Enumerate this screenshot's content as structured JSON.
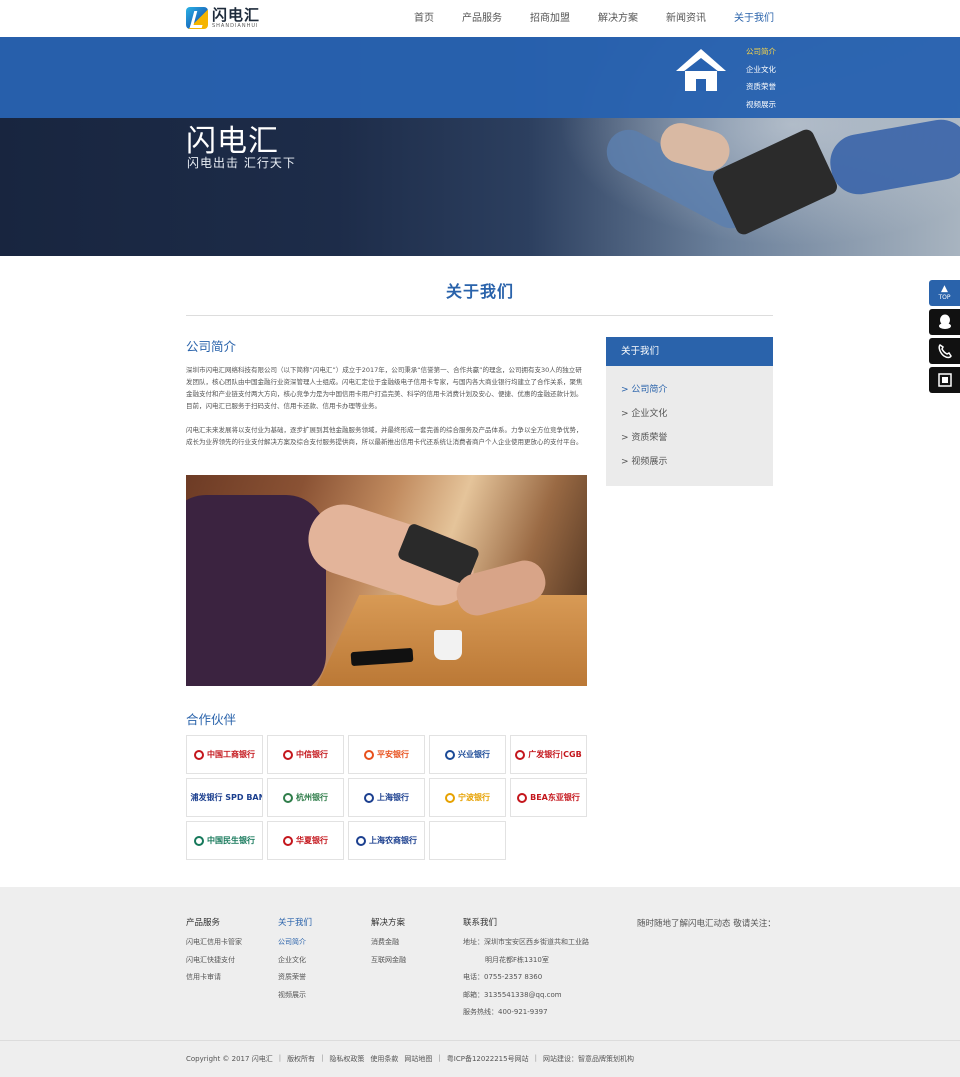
{
  "logo": {
    "name": "闪电汇",
    "sub": "SHANDIANHUI"
  },
  "nav": [
    {
      "label": "首页",
      "active": false
    },
    {
      "label": "产品服务",
      "active": false
    },
    {
      "label": "招商加盟",
      "active": false
    },
    {
      "label": "解决方案",
      "active": false
    },
    {
      "label": "新闻资讯",
      "active": false
    },
    {
      "label": "关于我们",
      "active": true
    }
  ],
  "dropdown": {
    "icon": "home-icon",
    "items": [
      "公司简介",
      "企业文化",
      "资质荣誉",
      "视频展示"
    ],
    "active_index": 0
  },
  "banner": {
    "title": "闪电汇",
    "subtitle": "闪电出击  汇行天下"
  },
  "section_title": "关于我们",
  "intro": {
    "heading": "公司简介",
    "paragraph1": "深圳市闪电汇网络科技有限公司（以下简称“闪电汇”）成立于2017年，公司秉承“信誉第一、合作共赢”的理念，公司拥有支30人的独立研发团队，核心团队由中国金融行业资深管理人士组成。闪电汇定位于金融级电子信用卡专家，与国内各大商业银行均建立了合作关系，聚焦金融支付和产业链支付两大方向，核心竞争力是为中国信用卡用户打造完美、科学的信用卡消费计划及安心、便捷、优惠的金融还款计划。目前，闪电汇已服务于扫码支付、信用卡还款、信用卡办理等业务。",
    "paragraph2": "闪电汇未来发展将以支付业为基础，逐步扩展到其他金融服务领域，并最终形成一套完善的综合服务及产品体系。力争以全方位竞争优势，成长为业界领先的行业支付解决方案及综合支付服务提供商，所以最新推出信用卡代还系统让消费者商户个人企业使用更放心的支付平台。"
  },
  "partners": {
    "heading": "合作伙伴",
    "items": [
      {
        "name": "中国工商银行",
        "color": "#c4161c"
      },
      {
        "name": "中信银行",
        "color": "#c4161c"
      },
      {
        "name": "平安银行",
        "color": "#e8501c"
      },
      {
        "name": "兴业银行",
        "color": "#1b4a97"
      },
      {
        "name": "广发银行|CGB",
        "color": "#c4161c"
      },
      {
        "name": "浦发银行 SPD BANK",
        "color": "#1b3f8f"
      },
      {
        "name": "杭州银行",
        "color": "#2f7d4a"
      },
      {
        "name": "上海银行",
        "color": "#1b3f8f"
      },
      {
        "name": "宁波银行",
        "color": "#e6a100"
      },
      {
        "name": "BEA东亚银行",
        "color": "#c4161c"
      },
      {
        "name": "中国民生银行",
        "color": "#15785a"
      },
      {
        "name": "华夏银行",
        "color": "#c4161c"
      },
      {
        "name": "上海农商银行",
        "color": "#1b3f8f"
      },
      {
        "name": "",
        "color": "#cccccc"
      }
    ]
  },
  "sidebar": {
    "title": "关于我们",
    "items": [
      "> 公司简介",
      "> 企业文化",
      "> 资质荣誉",
      "> 视频展示"
    ],
    "active_index": 0
  },
  "tools": {
    "top_label": "TOP",
    "icons": [
      "qq-icon",
      "phone-icon",
      "qrcode-icon"
    ]
  },
  "footer": {
    "columns": [
      {
        "title": "产品服务",
        "active": false,
        "links": [
          "闪电汇信用卡管家",
          "闪电汇快捷支付",
          "信用卡审请"
        ]
      },
      {
        "title": "关于我们",
        "active": true,
        "links": [
          "公司简介",
          "企业文化",
          "资质荣誉",
          "视频展示"
        ]
      },
      {
        "title": "解决方案",
        "active": false,
        "links": [
          "消费金融",
          "互联网金融"
        ]
      },
      {
        "title": "联系我们",
        "active": false,
        "links": [
          "地址：深圳市宝安区西乡街道共和工业路",
          "明月花都F栋1310室",
          "电话：0755-2357 8360",
          "邮箱：3135541338@qq.com",
          "服务热线：400-921-9397"
        ]
      }
    ],
    "follow": "随时随地了解闪电汇动态 敬请关注：",
    "copyright": [
      "Copyright © 2017 闪电汇",
      "|",
      "版权所有",
      "|",
      "隐私权政策",
      "使用条款",
      "网站地图",
      "|",
      "粤ICP备12022215号网站",
      "|",
      "网站建设：智意品牌策划机构"
    ]
  }
}
